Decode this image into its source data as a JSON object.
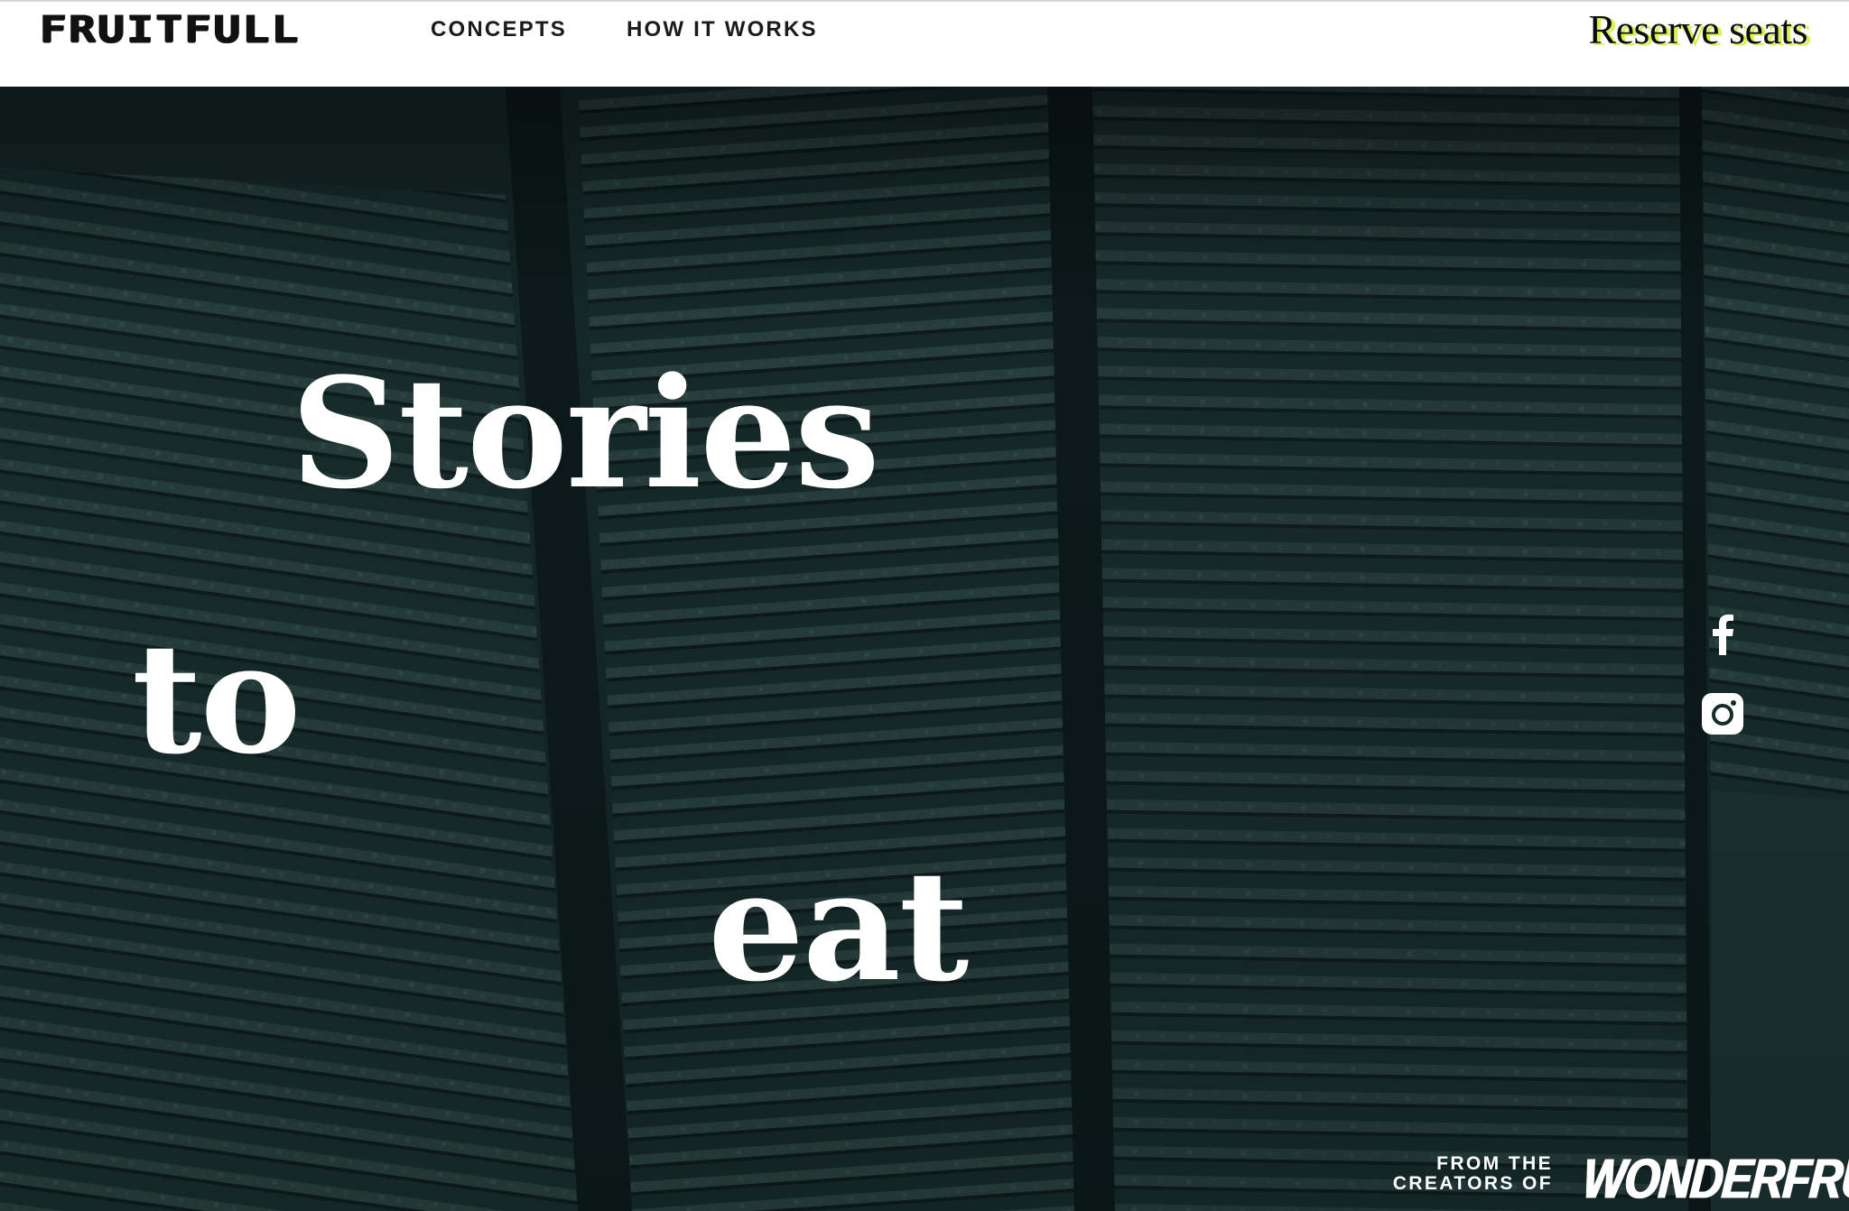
{
  "header": {
    "logo_text": "FRUITFULL",
    "nav": {
      "concepts_label": "CONCEPTS",
      "how_it_works_label": "HOW IT WORKS"
    },
    "reserve_label": "Reserve seats",
    "reserve_highlight_color": "#d8f24a"
  },
  "hero": {
    "background_color": "#172b2b",
    "headline": {
      "word1": "Stories",
      "word2": "to",
      "word3": "eat"
    },
    "social": {
      "facebook_icon": "facebook-icon",
      "instagram_icon": "instagram-icon"
    },
    "footer_credit": {
      "line1": "FROM THE",
      "line2": "CREATORS OF",
      "brand_logo_text": "WONDERFRUIT"
    }
  }
}
